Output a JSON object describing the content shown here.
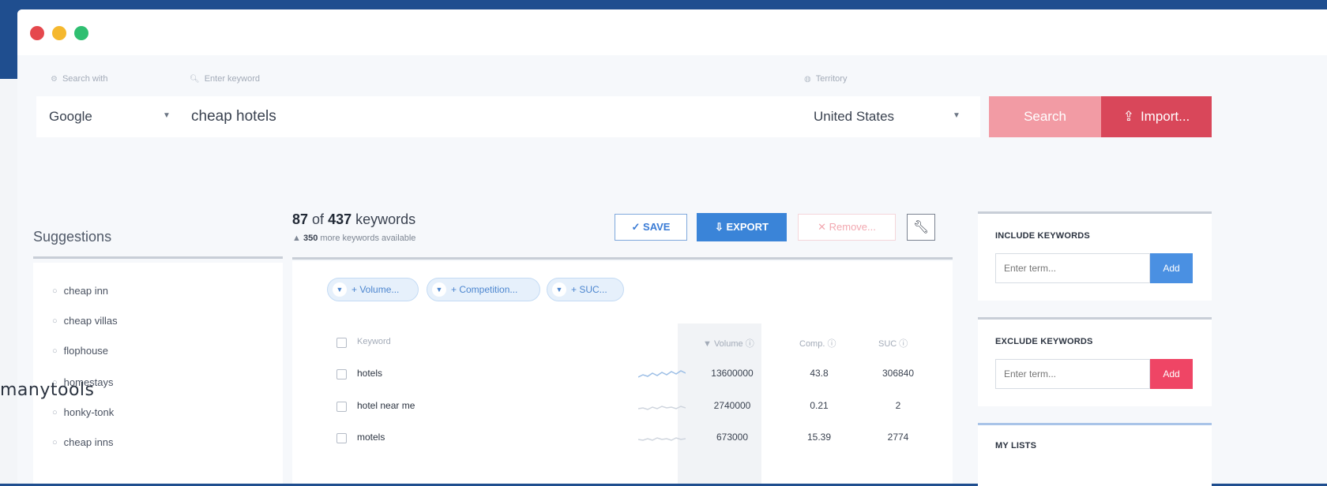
{
  "search": {
    "engine_label": "Search with",
    "keyword_label": "Enter keyword",
    "territory_label": "Territory",
    "engine_value": "Google",
    "keyword_value": "cheap hotels",
    "country_value": "United States",
    "search_button": "Search",
    "import_button": "Import..."
  },
  "suggestions": {
    "title": "Suggestions",
    "items": [
      "cheap inn",
      "cheap villas",
      "flophouse",
      "homestays",
      "honky-tonk",
      "cheap inns"
    ]
  },
  "results": {
    "shown": "87",
    "of_word": "of",
    "total": "437",
    "keywords_word": "keywords",
    "more_count": "350",
    "more_text": "more keywords available"
  },
  "toolbar": {
    "save": "SAVE",
    "export": "EXPORT",
    "remove": "Remove..."
  },
  "filters": [
    {
      "label": "+ Volume..."
    },
    {
      "label": "+ Competition..."
    },
    {
      "label": "+ SUC..."
    }
  ],
  "table": {
    "columns": {
      "keyword": "Keyword",
      "volume": "Volume",
      "comp": "Comp.",
      "suc": "SUC"
    },
    "rows": [
      {
        "keyword": "hotels",
        "volume": "13600000",
        "comp": "43.8",
        "suc": "306840"
      },
      {
        "keyword": "hotel near me",
        "volume": "2740000",
        "comp": "0.21",
        "suc": "2"
      },
      {
        "keyword": "motels",
        "volume": "673000",
        "comp": "15.39",
        "suc": "2774"
      }
    ]
  },
  "side": {
    "include_title": "INCLUDE KEYWORDS",
    "exclude_title": "EXCLUDE KEYWORDS",
    "lists_title": "MY LISTS",
    "input_placeholder": "Enter term...",
    "add": "Add"
  },
  "watermark": "manytools",
  "colors": {
    "accent_blue": "#3a84d8",
    "accent_red": "#d9475a",
    "search_pink": "#f29ba4",
    "include_add": "#4a90e2",
    "exclude_add": "#ef4565"
  }
}
